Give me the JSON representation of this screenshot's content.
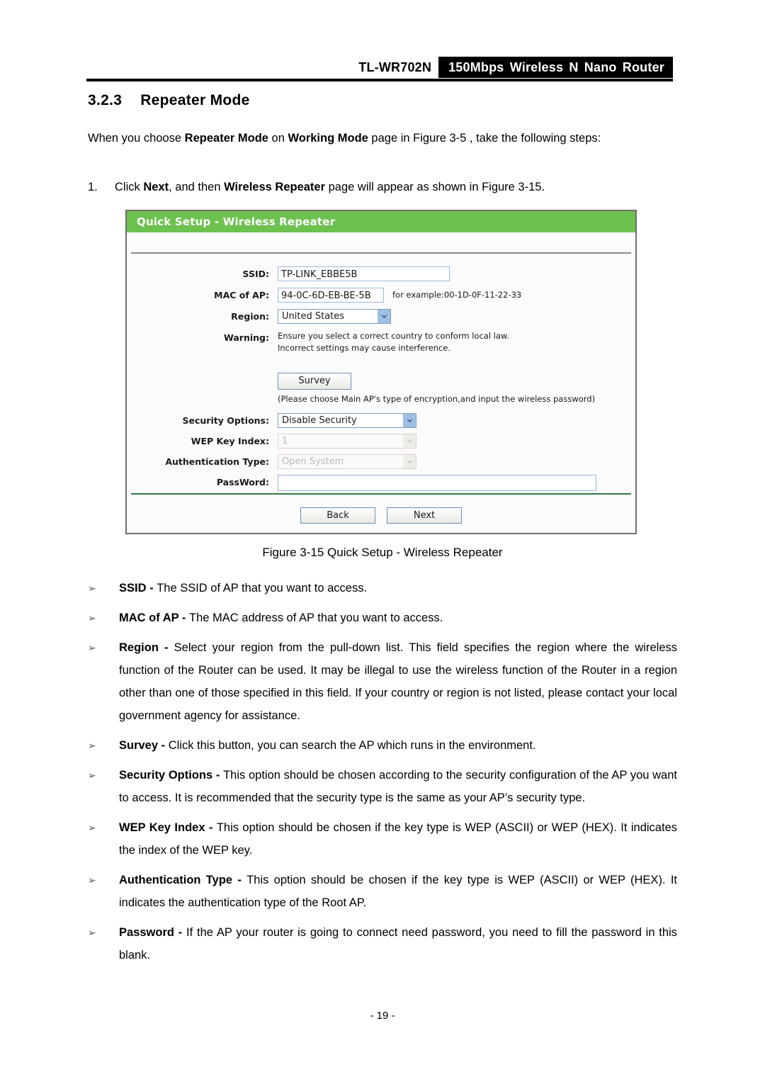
{
  "header": {
    "model": "TL-WR702N",
    "product": "150Mbps Wireless N Nano Router"
  },
  "section": {
    "number": "3.2.3",
    "title": "Repeater Mode"
  },
  "intro": {
    "prefix": "When you choose ",
    "bold1": "Repeater Mode",
    "mid1": " on ",
    "bold2": "Working Mode",
    "suffix": " page in Figure 3-5 , take the following steps:"
  },
  "step": {
    "number": "1.",
    "prefix": "Click ",
    "bold1": "Next",
    "mid1": ", and then ",
    "bold2": "Wireless Repeater",
    "suffix": " page will appear as shown in Figure 3-15."
  },
  "router_ui": {
    "title": "Quick Setup - Wireless Repeater",
    "labels": {
      "ssid": "SSID:",
      "mac_of_ap": "MAC of AP:",
      "region": "Region:",
      "warning": "Warning:",
      "security_options": "Security Options:",
      "wep_key_index": "WEP Key Index:",
      "authentication_type": "Authentication Type:",
      "password": "PassWord:"
    },
    "values": {
      "ssid": "TP-LINK_EBBE5B",
      "mac_of_ap": "94-0C-6D-EB-BE-5B",
      "mac_example": "for example:00-1D-0F-11-22-33",
      "region": "United States",
      "warning_line1": "Ensure you select a correct country to conform local law.",
      "warning_line2": "Incorrect settings may cause interference.",
      "security_options": "Disable Security",
      "wep_key_index": "1",
      "authentication_type": "Open System",
      "password": ""
    },
    "placeholders": {
      "password": ""
    },
    "buttons": {
      "survey": "Survey",
      "back": "Back",
      "next": "Next"
    },
    "hint": "(Please choose Main AP's type of encryption,and input the wireless password)",
    "colors": {
      "title_bar": "#6dc14e",
      "bottom_divider": "#2f7a43",
      "input_border": "#9bb8d6",
      "select_arrow": "#9dc0e4"
    }
  },
  "figure_caption": "Figure 3-15 Quick Setup - Wireless Repeater",
  "bullets": [
    {
      "marker": "➢",
      "term": "SSID - ",
      "text": "The SSID of AP that you want to access."
    },
    {
      "marker": "➢",
      "term": "MAC of AP - ",
      "text": "The MAC address of AP that you want to access."
    },
    {
      "marker": "➢",
      "term": "Region - ",
      "text": "Select your region from the pull-down list. This field specifies the region where the wireless function of the Router can be used. It may be illegal to use the wireless function of the Router in a region other than one of those specified in this field. If your country or region is not listed, please contact your local government agency for assistance."
    },
    {
      "marker": "➢",
      "term": "Survey - ",
      "text": "Click this button, you can search the AP which runs in the environment."
    },
    {
      "marker": "➢",
      "term": "Security Options - ",
      "text": "This option should be chosen according to the security configuration of the AP you want to access. It is recommended that the security type is the same as your AP’s security type."
    },
    {
      "marker": "➢",
      "term": "WEP Key Index - ",
      "text": "This option should be chosen if the key type is WEP (ASCII) or WEP (HEX). It indicates the index of the WEP key."
    },
    {
      "marker": "➢",
      "term": "Authentication Type - ",
      "text": "This option should be chosen if the key type is WEP (ASCII) or WEP (HEX). It indicates the authentication type of the Root AP."
    },
    {
      "marker": "➢",
      "term": "Password - ",
      "text": "If the AP your router is going to connect need password, you need to fill the password in this blank."
    }
  ],
  "page_number": "- 19 -"
}
